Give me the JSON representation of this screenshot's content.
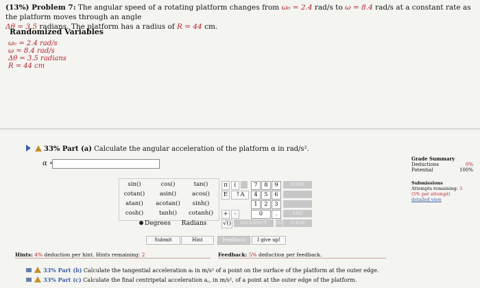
{
  "problem": {
    "label": "(13%) Problem 7:",
    "text_1": " The angular speed of a rotating platform changes from ",
    "w0_sym": "ω₀",
    "w0_val": " = 2.4",
    "text_2": " rad/s to ",
    "w_sym": "ω",
    "w_val": " = 8.4",
    "text_3": " rad/s at a constant rate as the platform moves through an angle",
    "dtheta_sym": "Δθ",
    "dtheta_val": " = 3.5",
    "text_4": " radians. The platform has a radius of ",
    "r_sym": "R",
    "r_val": " = 44",
    "text_5": " cm."
  },
  "randomized": {
    "title": "Randomized Variables",
    "lines": [
      "ω₀ = 2.4 rad/s",
      "ω = 8.4 rad/s",
      "Δθ = 3.5 radians",
      "R = 44 cm"
    ]
  },
  "part_a": {
    "label": "33% Part (a)",
    "text": " Calculate the angular acceleration of the platform α in rad/s².",
    "answer_label": "α =",
    "answer_value": ""
  },
  "keypad": {
    "functions": [
      [
        "sin()",
        "cos()",
        "tan()"
      ],
      [
        "cotan()",
        "asin()",
        "acos()"
      ],
      [
        "atan()",
        "acotan()",
        "sinh()"
      ],
      [
        "cosh()",
        "tanh()",
        "cotanh()"
      ]
    ],
    "degrees": "Degrees",
    "radians": "Radians",
    "symbols": [
      "π",
      "(",
      "E",
      "↑A",
      "+",
      "-",
      "√()"
    ],
    "numbers": [
      "7",
      "8",
      "9",
      "4",
      "5",
      "6",
      "1",
      "2",
      "3",
      "0",
      "."
    ],
    "home": "HOME",
    "end": "END",
    "backspace": "BACKSPACE",
    "del": "DEL",
    "clear": "CLEAR"
  },
  "buttons": {
    "submit": "Submit",
    "hint": "Hint",
    "feedback": "Feedback",
    "give_up": "I give up!"
  },
  "hints": {
    "prefix": "Hints:",
    "pct": "4%",
    "text": " deduction per hint. Hints remaining:",
    "remaining": "2"
  },
  "feedback": {
    "prefix": "Feedback:",
    "pct": "5%",
    "text": " deduction per feedback."
  },
  "grade_summary": {
    "title": "Grade Summary",
    "deductions_label": "Deductions",
    "deductions_value": "0%",
    "potential_label": "Potential",
    "potential_value": "100%"
  },
  "submissions": {
    "title": "Submissions",
    "attempts_label": "Attempts remaining:",
    "attempts_value": "3",
    "per_attempt": "(5% per attempt)",
    "detailed": "detailed view"
  },
  "part_b": {
    "label": "33% Part (b)",
    "text": " Calculate the tangential acceleration aₜ in m/s² of a point on the surface of the platform at the outer edge."
  },
  "part_c": {
    "label": "33% Part (c)",
    "text": " Calculate the final centripetal acceleration a꜀, in m/s², of a point at the outer edge of the platform."
  },
  "colors": {
    "accent_red": "#b3262b",
    "accent_blue": "#3a5ea8",
    "warning_orange": "#c3902a"
  }
}
